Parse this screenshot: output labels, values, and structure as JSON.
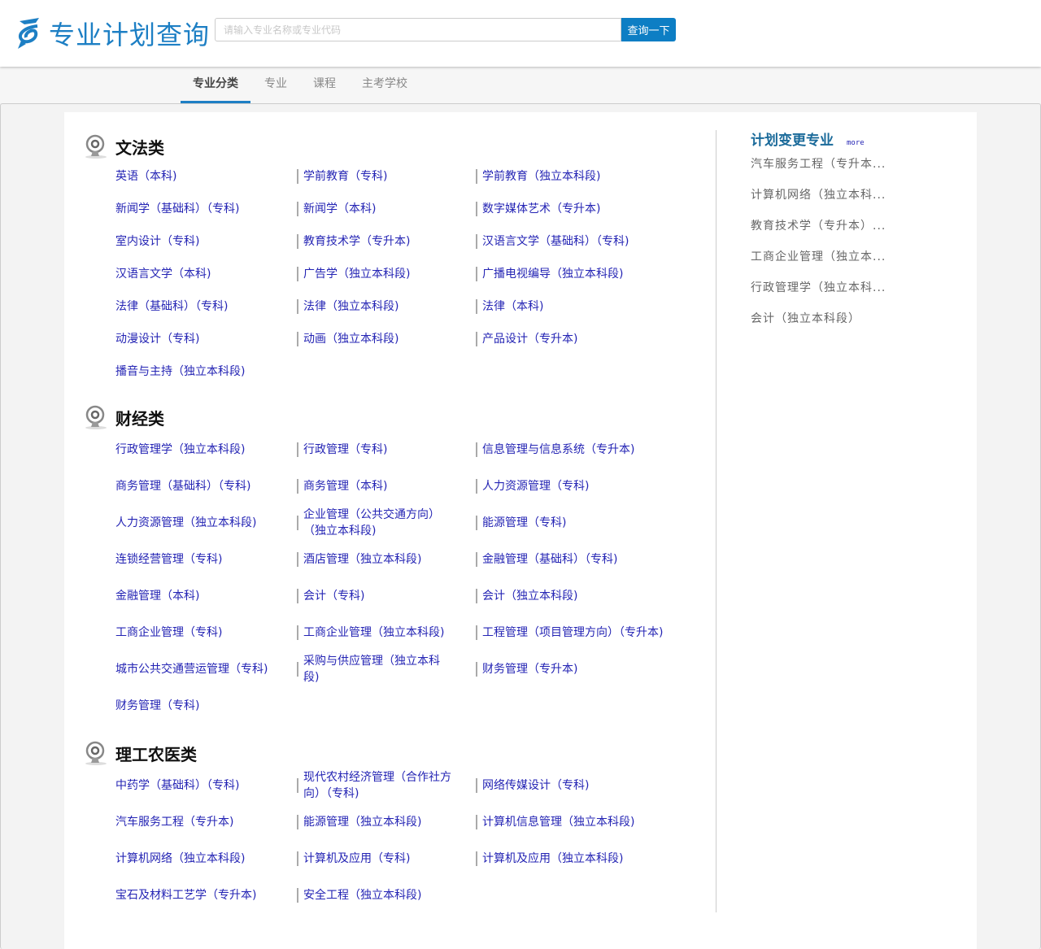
{
  "header": {
    "title": "专业计划查询",
    "search_placeholder": "请输入专业名称或专业代码",
    "search_button": "查询一下"
  },
  "nav": {
    "tabs": [
      {
        "label": "专业分类"
      },
      {
        "label": "专业"
      },
      {
        "label": "课程"
      },
      {
        "label": "主考学校"
      }
    ]
  },
  "categories": [
    {
      "title": "文法类",
      "items": [
        [
          "英语（本科)",
          "学前教育（专科)",
          "学前教育（独立本科段)"
        ],
        [
          "新闻学（基础科）（专科)",
          "新闻学（本科)",
          "数字媒体艺术（专升本)"
        ],
        [
          "室内设计（专科)",
          "教育技术学（专升本)",
          "汉语言文学（基础科）（专科)"
        ],
        [
          "汉语言文学（本科)",
          "广告学（独立本科段)",
          "广播电视编导（独立本科段)"
        ],
        [
          "法律（基础科）（专科)",
          "法律（独立本科段)",
          "法律（本科)"
        ],
        [
          "动漫设计（专科)",
          "动画（独立本科段)",
          "产品设计（专升本)"
        ],
        [
          "播音与主持（独立本科段)"
        ]
      ]
    },
    {
      "title": "财经类",
      "items": [
        [
          "行政管理学（独立本科段)",
          "行政管理（专科)",
          "信息管理与信息系统（专升本)"
        ],
        [
          "商务管理（基础科）（专科)",
          "商务管理（本科)",
          "人力资源管理（专科)"
        ],
        [
          "人力资源管理（独立本科段)",
          "企业管理（公共交通方向）（独立本科段)",
          "能源管理（专科)"
        ],
        [
          "连锁经营管理（专科)",
          "酒店管理（独立本科段)",
          "金融管理（基础科）（专科)"
        ],
        [
          "金融管理（本科)",
          "会计（专科)",
          "会计（独立本科段)"
        ],
        [
          "工商企业管理（专科)",
          "工商企业管理（独立本科段)",
          "工程管理（项目管理方向）（专升本)"
        ],
        [
          "城市公共交通营运管理（专科)",
          "采购与供应管理（独立本科段)",
          "财务管理（专升本)"
        ],
        [
          "财务管理（专科)"
        ]
      ]
    },
    {
      "title": "理工农医类",
      "items": [
        [
          "中药学（基础科）（专科)",
          "现代农村经济管理（合作社方向）（专科)",
          "网络传媒设计（专科)"
        ],
        [
          "汽车服务工程（专升本)",
          "能源管理（独立本科段)",
          "计算机信息管理（独立本科段)"
        ],
        [
          "计算机网络（独立本科段)",
          "计算机及应用（专科)",
          "计算机及应用（独立本科段)"
        ],
        [
          "宝石及材料工艺学（专升本)",
          "安全工程（独立本科段)"
        ]
      ]
    }
  ],
  "sidebar": {
    "title": "计划变更专业",
    "more": "more",
    "items": [
      "汽车服务工程（专升本...",
      "计算机网络（独立本科...",
      "教育技术学（专升本）...",
      "工商企业管理（独立本...",
      "行政管理学（独立本科...",
      "会计（独立本科段）"
    ]
  }
}
